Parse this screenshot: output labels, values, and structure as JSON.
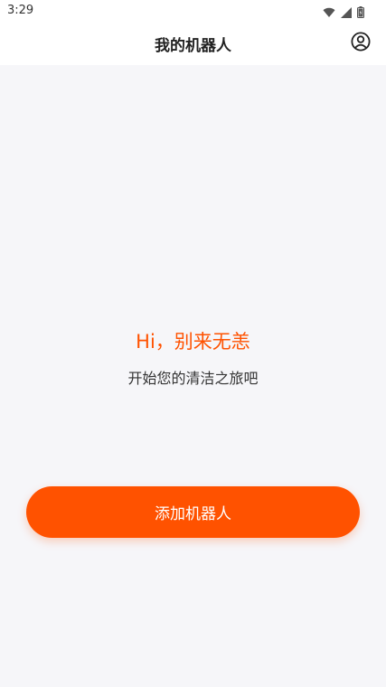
{
  "status_bar": {
    "time": "3:29",
    "icons": [
      "wifi-icon",
      "signal-icon",
      "battery-icon"
    ]
  },
  "app_bar": {
    "title": "我的机器人",
    "profile_icon": "user-circle-icon"
  },
  "main": {
    "greeting": "Hi，别来无恙",
    "subtitle": "开始您的清洁之旅吧",
    "add_button_label": "添加机器人"
  },
  "colors": {
    "accent": "#ff5200",
    "background": "#f6f6f9",
    "header_background": "#ffffff",
    "title_text": "#222222"
  }
}
